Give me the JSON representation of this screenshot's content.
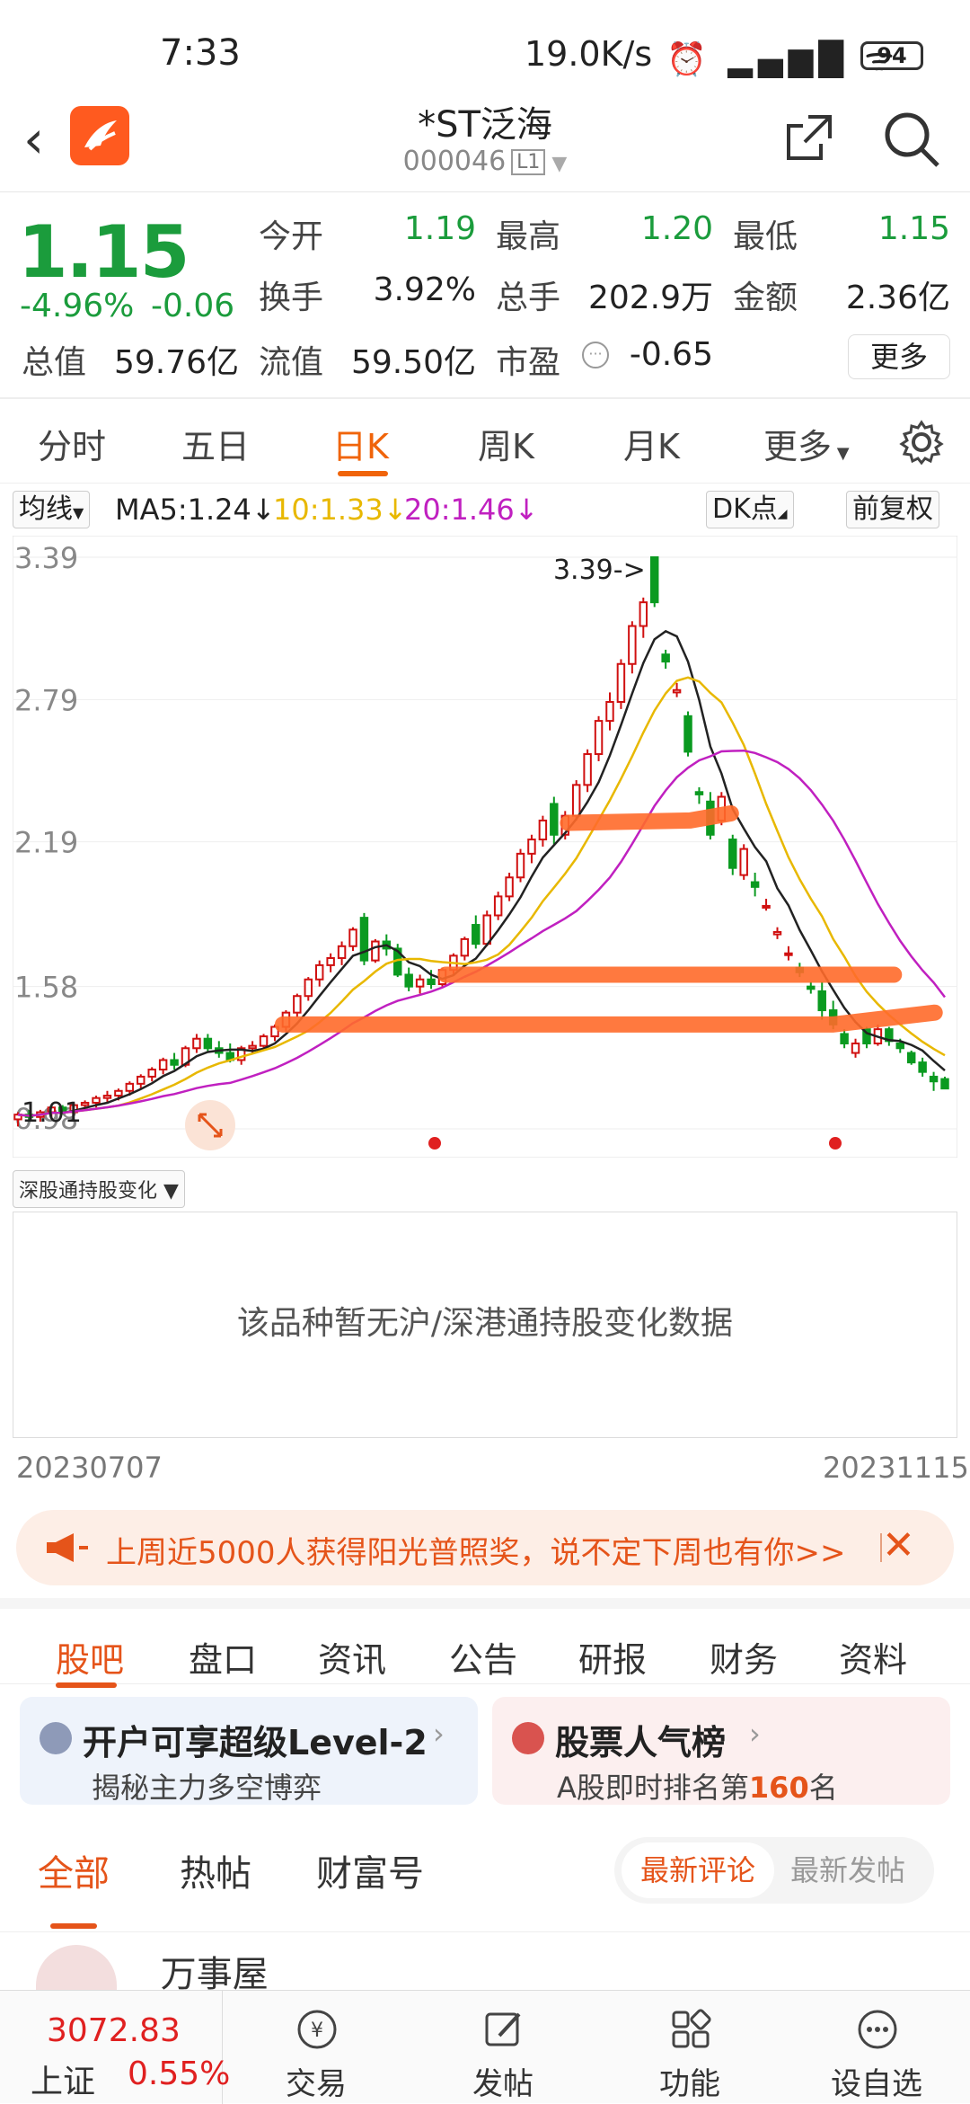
{
  "status": {
    "time": "7:33",
    "network": "19.0K/s",
    "battery": "94"
  },
  "header": {
    "title": "*ST泛海",
    "code": "000046",
    "level": "L1"
  },
  "quote": {
    "price": "1.15",
    "pct": "-4.96%",
    "change": "-0.06",
    "rows": [
      [
        {
          "label": "今开",
          "value": "1.19",
          "green": true
        },
        {
          "label": "最高",
          "value": "1.20",
          "green": true
        },
        {
          "label": "最低",
          "value": "1.15",
          "green": true
        }
      ],
      [
        {
          "label": "换手",
          "value": "3.92%"
        },
        {
          "label": "总手",
          "value": "202.9万"
        },
        {
          "label": "金额",
          "value": "2.36亿"
        }
      ],
      [
        {
          "label": "总值",
          "value": "59.76亿"
        },
        {
          "label": "流值",
          "value": "59.50亿"
        },
        {
          "label": "市盈",
          "value": "-0.65"
        }
      ]
    ],
    "more": "更多"
  },
  "ktabs": [
    "分时",
    "五日",
    "日K",
    "周K",
    "月K",
    "更多"
  ],
  "ma_bar": {
    "selector": "均线",
    "ma5": "MA5:1.24",
    "ma10": "10:1.33",
    "ma20": "20:1.46",
    "dk": "DK点",
    "fq": "前复权"
  },
  "colors": {
    "ma5": "#222222",
    "ma10": "#e8b800",
    "ma20": "#c020c0",
    "up": "#d01010",
    "down": "#0a9a20",
    "accent": "#f0640a"
  },
  "chart_data": {
    "type": "candlestick",
    "y_ticks": [
      "3.39",
      "2.79",
      "2.19",
      "1.58",
      "0.98"
    ],
    "ylim": [
      0.98,
      3.39
    ],
    "high_label": "3.39->",
    "low_label": "1.01",
    "candles": [
      [
        1.02,
        1.05,
        0.99,
        1.04
      ],
      [
        1.04,
        1.06,
        1.01,
        1.03
      ],
      [
        1.03,
        1.06,
        1.01,
        1.05
      ],
      [
        1.05,
        1.08,
        1.03,
        1.07
      ],
      [
        1.07,
        1.08,
        1.04,
        1.05
      ],
      [
        1.05,
        1.09,
        1.04,
        1.08
      ],
      [
        1.08,
        1.1,
        1.06,
        1.09
      ],
      [
        1.09,
        1.12,
        1.07,
        1.11
      ],
      [
        1.11,
        1.14,
        1.09,
        1.12
      ],
      [
        1.12,
        1.15,
        1.1,
        1.14
      ],
      [
        1.14,
        1.18,
        1.12,
        1.17
      ],
      [
        1.17,
        1.21,
        1.15,
        1.2
      ],
      [
        1.2,
        1.24,
        1.18,
        1.23
      ],
      [
        1.23,
        1.28,
        1.21,
        1.27
      ],
      [
        1.27,
        1.3,
        1.23,
        1.25
      ],
      [
        1.25,
        1.33,
        1.24,
        1.32
      ],
      [
        1.32,
        1.38,
        1.3,
        1.36
      ],
      [
        1.36,
        1.38,
        1.3,
        1.32
      ],
      [
        1.32,
        1.35,
        1.28,
        1.3
      ],
      [
        1.3,
        1.34,
        1.26,
        1.27
      ],
      [
        1.27,
        1.33,
        1.25,
        1.32
      ],
      [
        1.32,
        1.35,
        1.3,
        1.33
      ],
      [
        1.33,
        1.38,
        1.31,
        1.37
      ],
      [
        1.37,
        1.42,
        1.35,
        1.41
      ],
      [
        1.41,
        1.48,
        1.39,
        1.47
      ],
      [
        1.47,
        1.55,
        1.45,
        1.54
      ],
      [
        1.54,
        1.62,
        1.52,
        1.61
      ],
      [
        1.61,
        1.69,
        1.58,
        1.67
      ],
      [
        1.67,
        1.72,
        1.64,
        1.7
      ],
      [
        1.7,
        1.77,
        1.67,
        1.75
      ],
      [
        1.75,
        1.83,
        1.73,
        1.82
      ],
      [
        1.87,
        1.89,
        1.67,
        1.69
      ],
      [
        1.69,
        1.78,
        1.68,
        1.77
      ],
      [
        1.77,
        1.8,
        1.71,
        1.74
      ],
      [
        1.74,
        1.76,
        1.62,
        1.63
      ],
      [
        1.63,
        1.66,
        1.56,
        1.58
      ],
      [
        1.58,
        1.63,
        1.55,
        1.61
      ],
      [
        1.61,
        1.65,
        1.57,
        1.59
      ],
      [
        1.59,
        1.66,
        1.58,
        1.65
      ],
      [
        1.65,
        1.72,
        1.63,
        1.71
      ],
      [
        1.71,
        1.79,
        1.69,
        1.78
      ],
      [
        1.84,
        1.88,
        1.74,
        1.76
      ],
      [
        1.76,
        1.9,
        1.75,
        1.88
      ],
      [
        1.88,
        1.98,
        1.86,
        1.96
      ],
      [
        1.96,
        2.06,
        1.94,
        2.04
      ],
      [
        2.04,
        2.16,
        2.02,
        2.14
      ],
      [
        2.14,
        2.22,
        2.1,
        2.2
      ],
      [
        2.2,
        2.3,
        2.17,
        2.28
      ],
      [
        2.35,
        2.38,
        2.18,
        2.22
      ],
      [
        2.22,
        2.32,
        2.2,
        2.3
      ],
      [
        2.3,
        2.45,
        2.28,
        2.43
      ],
      [
        2.43,
        2.58,
        2.4,
        2.56
      ],
      [
        2.56,
        2.72,
        2.53,
        2.7
      ],
      [
        2.7,
        2.82,
        2.66,
        2.78
      ],
      [
        2.78,
        2.96,
        2.75,
        2.94
      ],
      [
        2.94,
        3.12,
        2.9,
        3.1
      ],
      [
        3.1,
        3.22,
        3.05,
        3.2
      ],
      [
        3.39,
        3.39,
        3.18,
        3.2
      ],
      [
        2.98,
        3.0,
        2.92,
        2.95
      ],
      [
        2.82,
        2.86,
        2.8,
        2.83
      ],
      [
        2.72,
        2.74,
        2.55,
        2.57
      ],
      [
        2.4,
        2.42,
        2.35,
        2.39
      ],
      [
        2.36,
        2.4,
        2.2,
        2.22
      ],
      [
        2.28,
        2.4,
        2.26,
        2.38
      ],
      [
        2.2,
        2.22,
        2.05,
        2.08
      ],
      [
        2.05,
        2.18,
        2.03,
        2.16
      ],
      [
        2.02,
        2.06,
        1.96,
        2.0
      ],
      [
        1.92,
        1.95,
        1.9,
        1.92
      ],
      [
        1.8,
        1.83,
        1.78,
        1.81
      ],
      [
        1.72,
        1.75,
        1.69,
        1.72
      ],
      [
        1.66,
        1.68,
        1.62,
        1.64
      ],
      [
        1.58,
        1.6,
        1.55,
        1.57
      ],
      [
        1.56,
        1.6,
        1.44,
        1.48
      ],
      [
        1.48,
        1.52,
        1.4,
        1.42
      ],
      [
        1.38,
        1.4,
        1.32,
        1.34
      ],
      [
        1.3,
        1.36,
        1.28,
        1.34
      ],
      [
        1.4,
        1.41,
        1.32,
        1.34
      ],
      [
        1.34,
        1.42,
        1.33,
        1.4
      ],
      [
        1.4,
        1.41,
        1.33,
        1.35
      ],
      [
        1.34,
        1.36,
        1.3,
        1.32
      ],
      [
        1.3,
        1.31,
        1.25,
        1.26
      ],
      [
        1.26,
        1.28,
        1.2,
        1.22
      ],
      [
        1.2,
        1.22,
        1.14,
        1.18
      ],
      [
        1.19,
        1.2,
        1.15,
        1.15
      ]
    ]
  },
  "hold": {
    "selector": "深股通持股变化",
    "empty": "该品种暂无沪/深港通持股变化数据"
  },
  "dates": {
    "start": "20230707",
    "end": "20231115"
  },
  "banner": {
    "text": "上周近5000人获得阳光普照奖，说不定下周也有你>>"
  },
  "news_tabs": [
    "股吧",
    "盘口",
    "资讯",
    "公告",
    "研报",
    "财务",
    "资料"
  ],
  "cards": [
    {
      "title": "开户可享超级Level-2",
      "sub": "揭秘主力多空博弈"
    },
    {
      "title": "股票人气榜",
      "sub_pre": "A股即时排名第",
      "sub_num": "160",
      "sub_post": "名"
    }
  ],
  "filter": {
    "tabs": [
      "全部",
      "热帖",
      "财富号"
    ],
    "sort": [
      "最新评论",
      "最新发帖"
    ]
  },
  "peek": "万事屋",
  "bottom": {
    "index_value": "3072.83",
    "index_name": "上证",
    "index_pct": "0.55%",
    "nav": [
      "交易",
      "发帖",
      "功能",
      "设自选"
    ]
  }
}
